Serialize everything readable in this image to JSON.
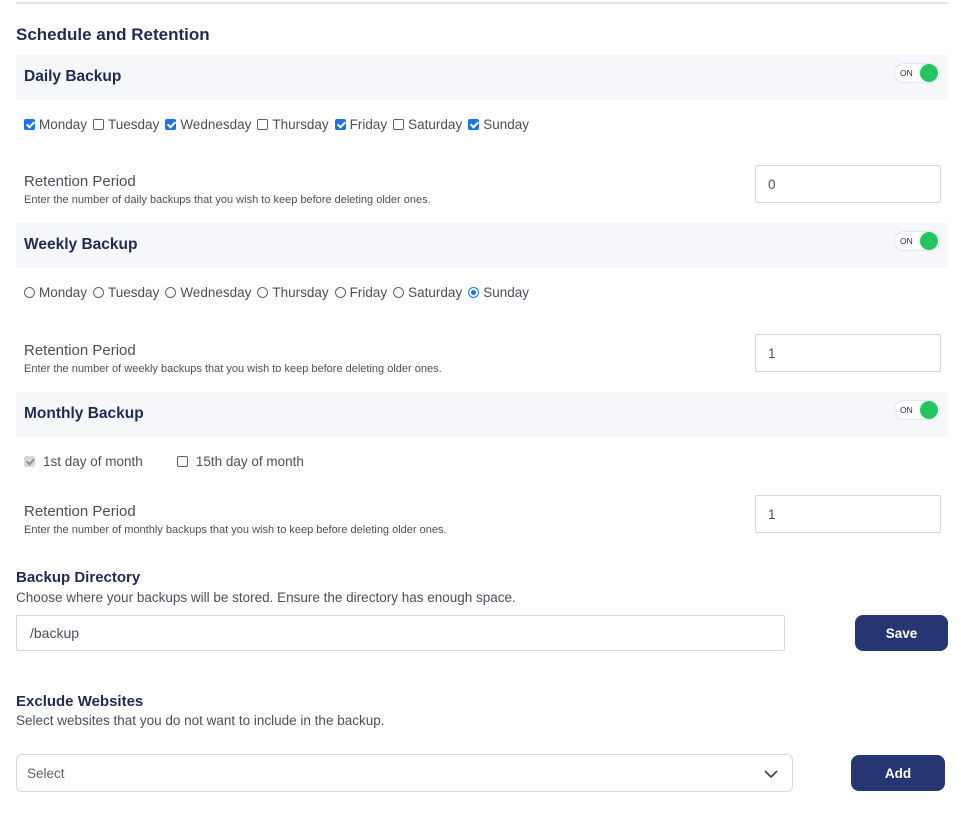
{
  "section": {
    "title": "Schedule and Retention"
  },
  "daily": {
    "title": "Daily Backup",
    "toggle": "ON",
    "days": [
      {
        "label": "Monday",
        "checked": true
      },
      {
        "label": "Tuesday",
        "checked": false
      },
      {
        "label": "Wednesday",
        "checked": true
      },
      {
        "label": "Thursday",
        "checked": false
      },
      {
        "label": "Friday",
        "checked": true
      },
      {
        "label": "Saturday",
        "checked": false
      },
      {
        "label": "Sunday",
        "checked": true
      }
    ],
    "retention_label": "Retention Period",
    "retention_help": "Enter the number of daily backups that you wish to keep before deleting older ones.",
    "retention_value": "0"
  },
  "weekly": {
    "title": "Weekly Backup",
    "toggle": "ON",
    "days": [
      {
        "label": "Monday",
        "checked": false
      },
      {
        "label": "Tuesday",
        "checked": false
      },
      {
        "label": "Wednesday",
        "checked": false
      },
      {
        "label": "Thursday",
        "checked": false
      },
      {
        "label": "Friday",
        "checked": false
      },
      {
        "label": "Saturday",
        "checked": false
      },
      {
        "label": "Sunday",
        "checked": true
      }
    ],
    "retention_label": "Retention Period",
    "retention_help": "Enter the number of weekly backups that you wish to keep before deleting older ones.",
    "retention_value": "1"
  },
  "monthly": {
    "title": "Monthly Backup",
    "toggle": "ON",
    "options": [
      {
        "label": "1st day of month",
        "checked": true,
        "disabled": true
      },
      {
        "label": "15th day of month",
        "checked": false,
        "disabled": false
      }
    ],
    "retention_label": "Retention Period",
    "retention_help": "Enter the number of monthly backups that you wish to keep before deleting older ones.",
    "retention_value": "1"
  },
  "directory": {
    "title": "Backup Directory",
    "help": "Choose where your backups will be stored. Ensure the directory has enough space.",
    "value": "/backup",
    "save_label": "Save"
  },
  "exclude": {
    "title": "Exclude Websites",
    "help": "Select websites that you do not want to include in the backup.",
    "select_placeholder": "Select",
    "add_label": "Add"
  },
  "colors": {
    "accent": "#263672",
    "toggle_on": "#22c55e",
    "check_blue": "#1a73e8",
    "heading": "#1e2b55"
  }
}
